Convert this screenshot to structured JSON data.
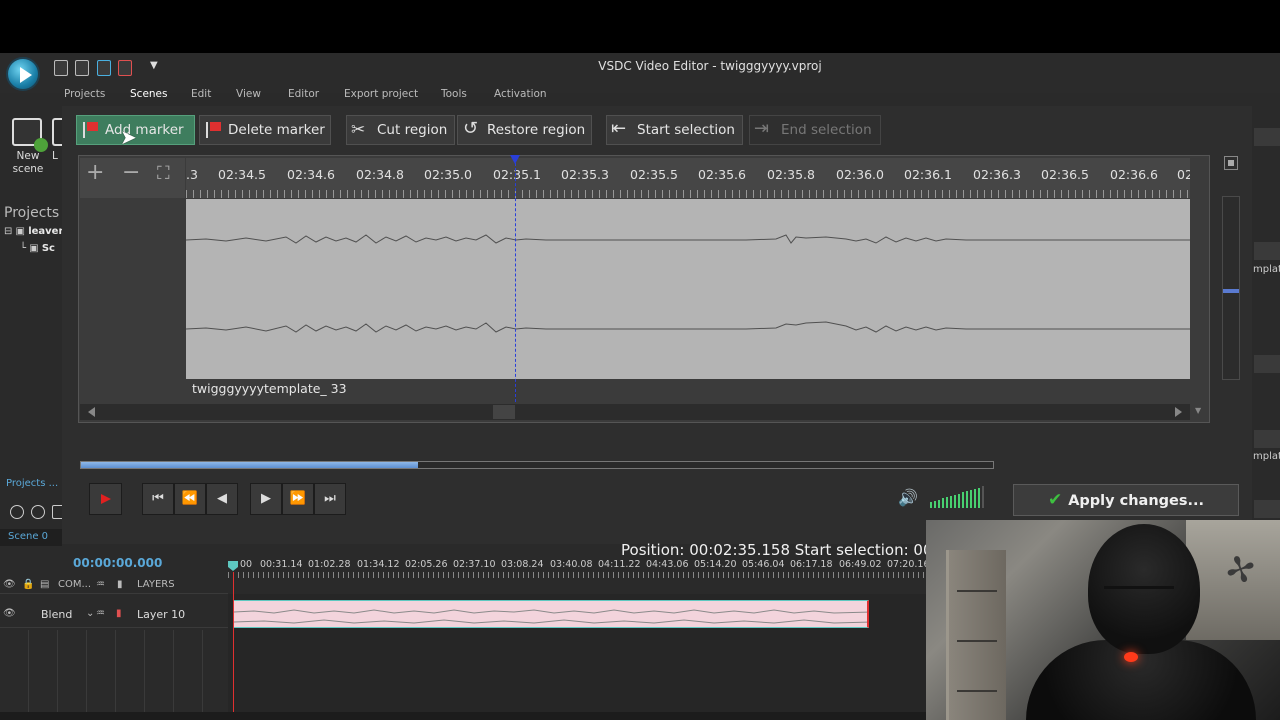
{
  "app": {
    "title": "VSDC Video Editor - twigggyyyy.vproj"
  },
  "menu": {
    "items": [
      "Projects",
      "Scenes",
      "Edit",
      "View",
      "Editor",
      "Export project",
      "Tools",
      "Activation"
    ],
    "active": "Scenes"
  },
  "ribbon": {
    "new_scene_label": "New scene",
    "partial_label": "L"
  },
  "projects_panel": {
    "heading": "Projects",
    "tree_root": "leaver",
    "tree_child": "Sc",
    "tab_label": "Projects ...",
    "scene_tab": "Scene 0"
  },
  "toolbar": {
    "add_marker": "Add marker",
    "delete_marker": "Delete marker",
    "cut_region": "Cut region",
    "restore_region": "Restore region",
    "start_selection": "Start selection",
    "end_selection": "End selection"
  },
  "waveform": {
    "ruler_labels": [
      ".3",
      "02:34.5",
      "02:34.6",
      "02:34.8",
      "02:35.0",
      "02:35.1",
      "02:35.3",
      "02:35.5",
      "02:35.6",
      "02:35.8",
      "02:36.0",
      "02:36.1",
      "02:36.3",
      "02:36.5",
      "02:36.6",
      "02"
    ],
    "clip_name": "twigggyyyytemplate_ 33"
  },
  "preview_progress": 0.37,
  "playback": {
    "volume_level": 0.9
  },
  "apply_button": "Apply changes...",
  "status": {
    "position_text": "Position: 00:02:35.158   Start selection: 00"
  },
  "timeline": {
    "time_display": "00:00:00.000",
    "ruler_labels": [
      "00",
      "00:31.14",
      "01:02.28",
      "01:34.12",
      "02:05.26",
      "02:37.10",
      "03:08.24",
      "03:40.08",
      "04:11.22",
      "04:43.06",
      "05:14.20",
      "05:46.04",
      "06:17.18",
      "06:49.02",
      "07:20.16"
    ],
    "header_com": "COM...",
    "header_layers": "LAYERS",
    "row_blend": "Blend",
    "row_layer": "Layer 10"
  },
  "right_panel": {
    "text1": "mplat",
    "text2": "mplat"
  },
  "colors": {
    "accent_green": "#3e7d5e",
    "playhead_blue": "#2a3fd8",
    "check_green": "#3ec040",
    "timeline_accent": "#5aa8d8"
  }
}
